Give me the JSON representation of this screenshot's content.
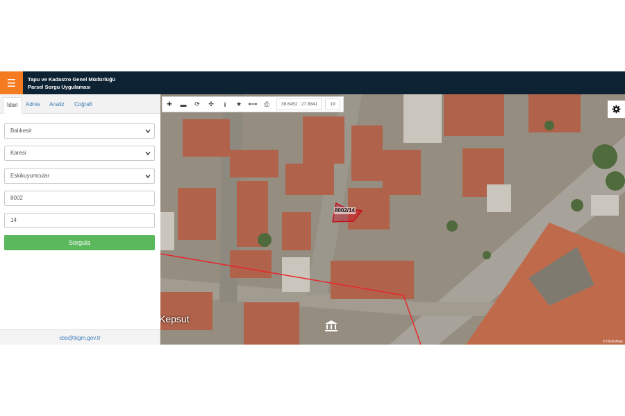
{
  "header": {
    "title_line1": "Tapu ve Kadastro Genel Müdürlüğü",
    "title_line2": "Parsel Sorgu Uygulaması"
  },
  "sidebar": {
    "tabs": [
      "İdari",
      "Adres",
      "Analiz",
      "Coğrafi"
    ],
    "active_tab": "İdari",
    "form": {
      "province": "Balıkesir",
      "district": "Karesi",
      "neighborhood": "Eskikuyumcular",
      "block": "8002",
      "parcel": "14"
    },
    "query_button": "Sorgula",
    "footer_email": "cbs@tkgm.gov.tr"
  },
  "map": {
    "coordinates": "39.6452 : 27.8841",
    "zoom": "19",
    "parcel_label": "8002/14",
    "place_name": "Kepsut",
    "attribution": "© HGM Atlas",
    "colors": {
      "header": "#0d2233",
      "menu_button": "#f47b20",
      "query_button": "#5cb85c",
      "boundary": "#e8262b"
    }
  }
}
